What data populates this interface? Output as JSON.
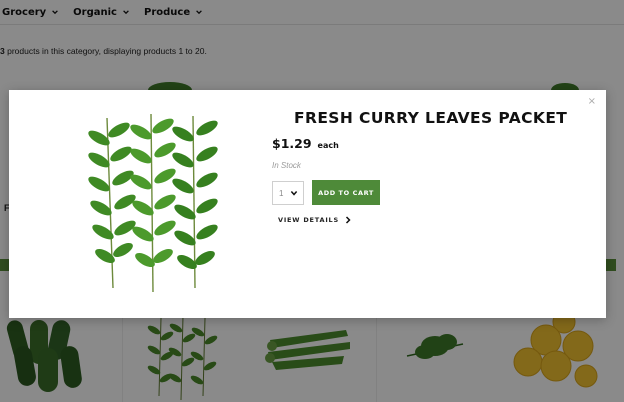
{
  "nav": {
    "items": [
      {
        "label": "Grocery",
        "icon": "chevron-down-icon"
      },
      {
        "label": "Organic",
        "icon": "chevron-down-icon"
      },
      {
        "label": "Produce",
        "icon": "chevron-down-icon"
      }
    ]
  },
  "category": {
    "count": "3",
    "summary": " products in this category, displaying products 1 to 20."
  },
  "background_products": [
    {
      "name": "cucumbers",
      "icon": "cucumbers-image"
    },
    {
      "name": "curry leaves",
      "icon": "curry-leaves-image"
    },
    {
      "name": "okra",
      "icon": "okra-image"
    },
    {
      "name": "dill",
      "icon": "dill-image"
    },
    {
      "name": "lemons",
      "icon": "lemons-image"
    }
  ],
  "modal": {
    "close": "×",
    "title": "FRESH CURRY LEAVES PACKET",
    "price": "$1.29",
    "unit": "each",
    "stock": "In Stock",
    "quantity": "1",
    "add_to_cart": "ADD TO CART",
    "view_details": "VIEW DETAILS"
  },
  "colors": {
    "accent": "#4e8a39",
    "overlay": "rgba(0,0,0,0.46)"
  }
}
